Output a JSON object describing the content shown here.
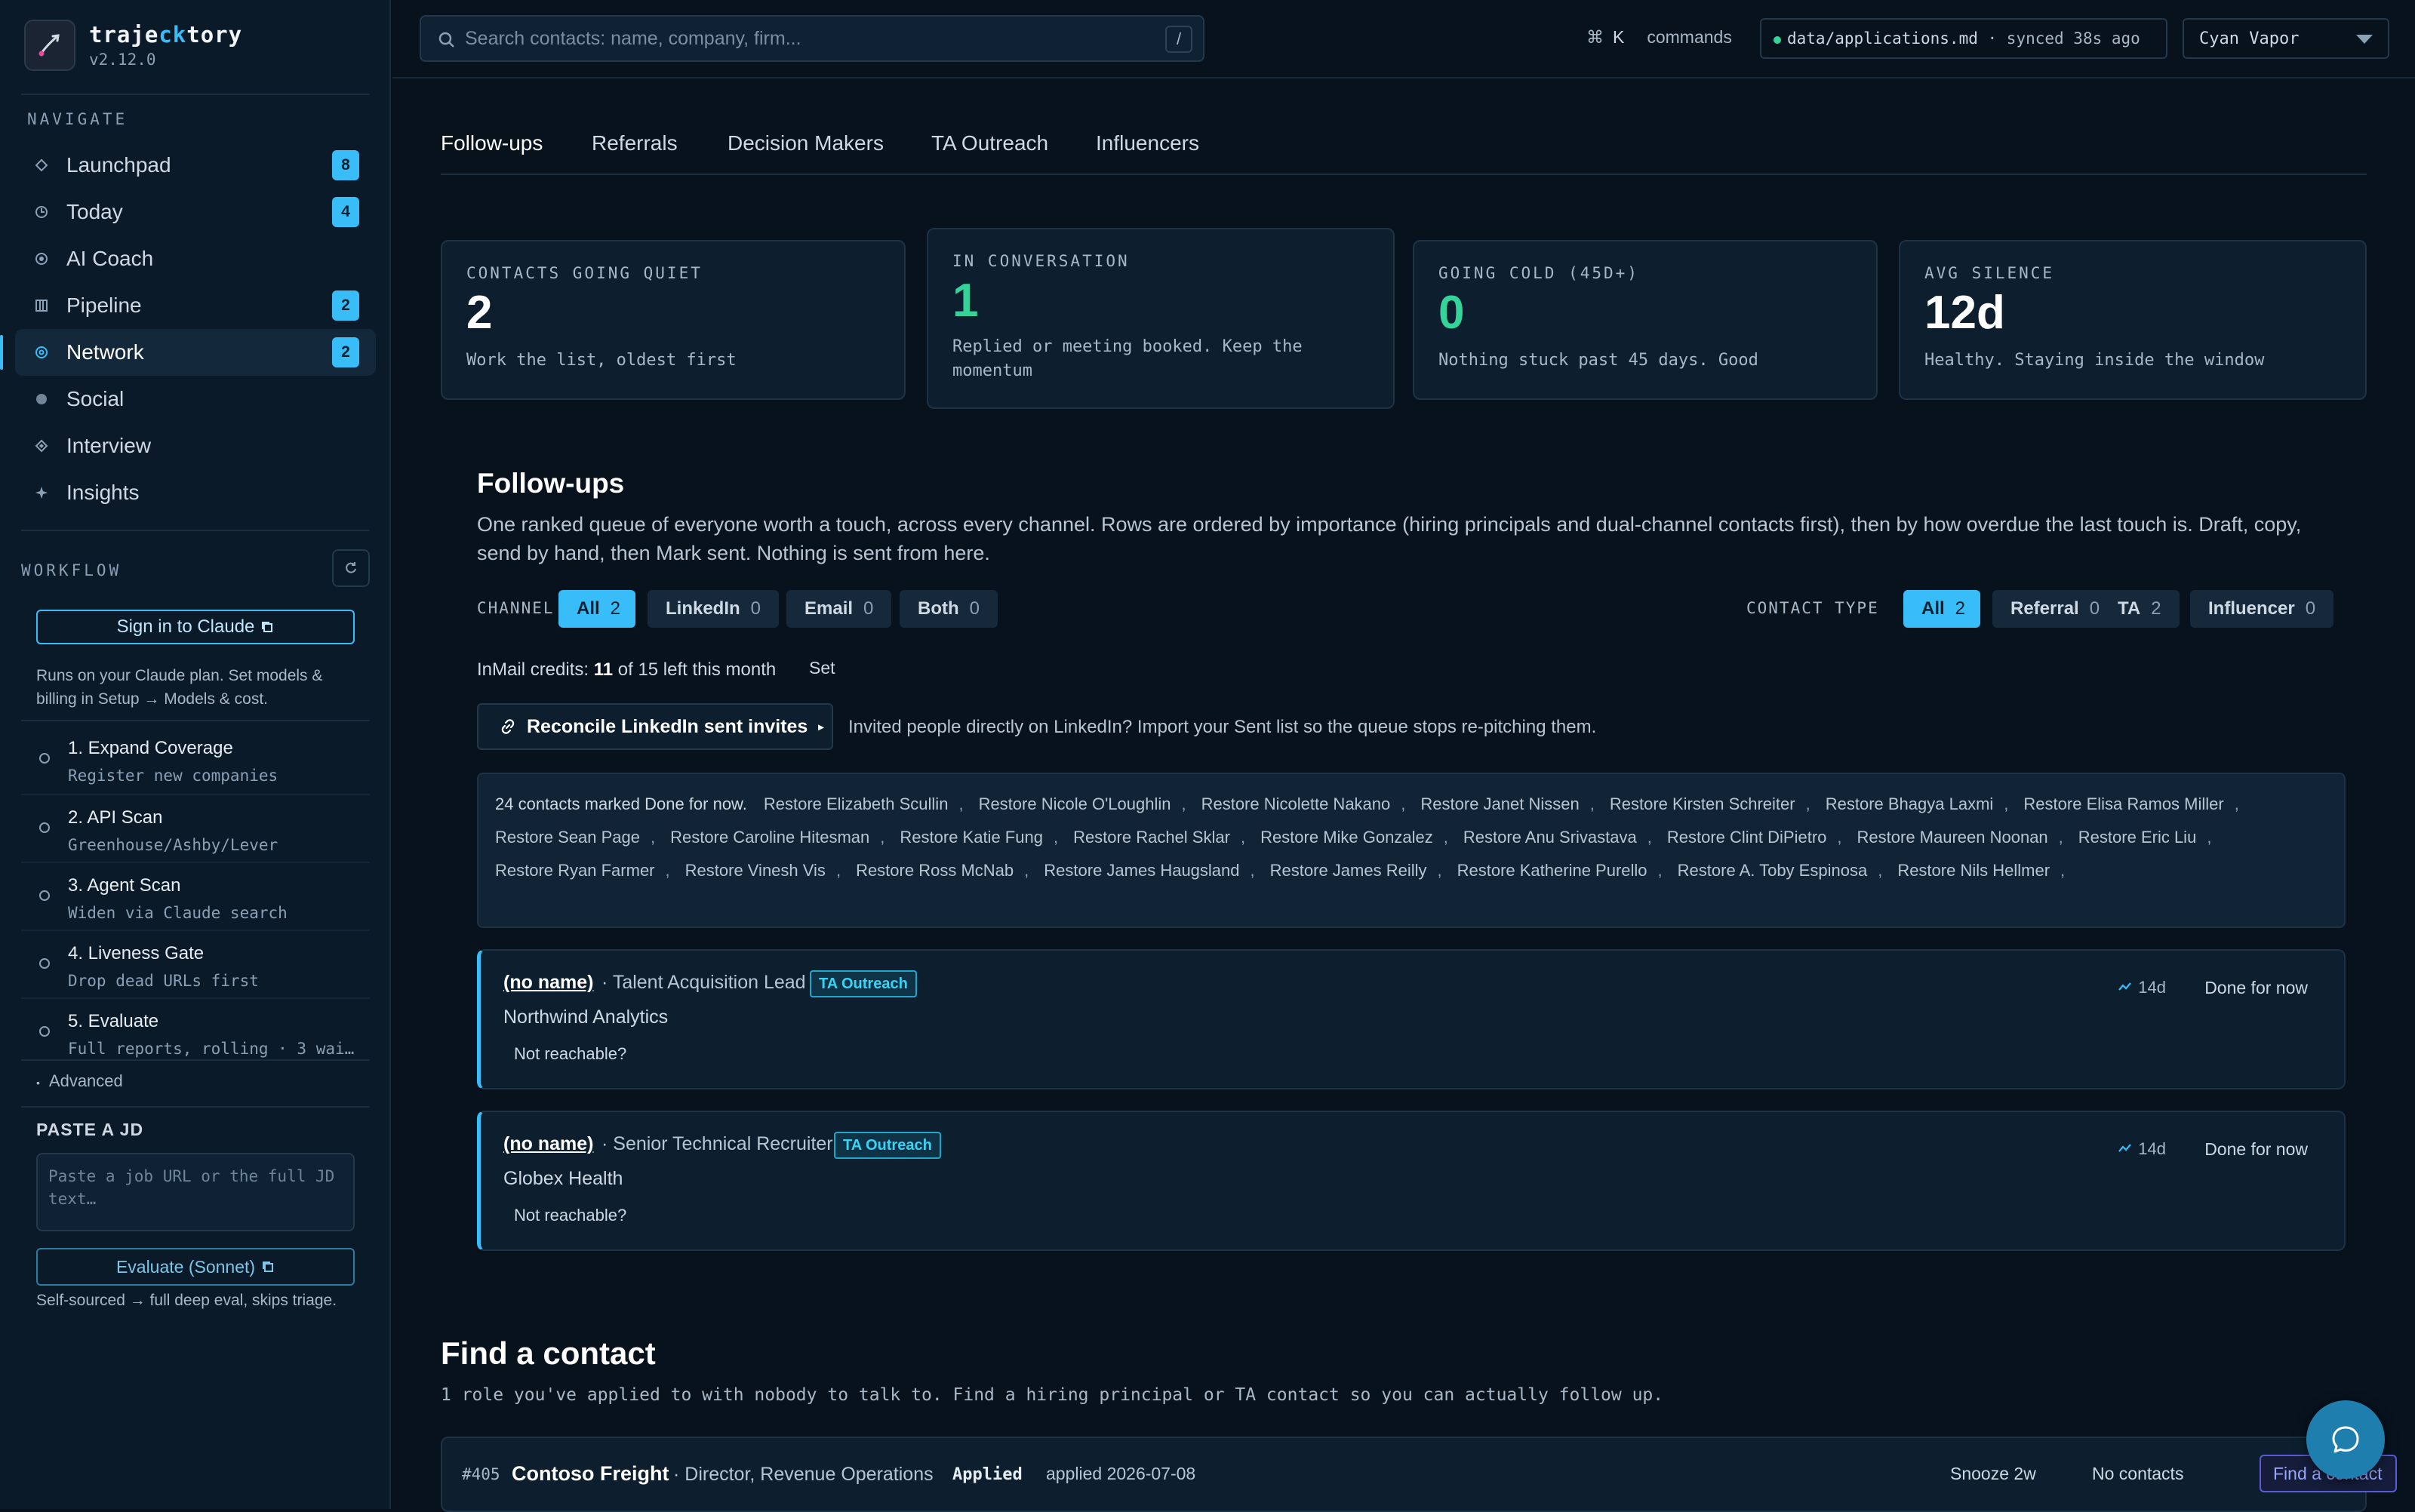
{
  "app": {
    "name_prefix": "traje",
    "name_accent": "ck",
    "name_suffix": "tory",
    "version": "v2.12.0"
  },
  "sidebar": {
    "navigate_title": "NAVIGATE",
    "nav": [
      {
        "label": "Launchpad",
        "badge": "8",
        "icon": "diamond-icon"
      },
      {
        "label": "Today",
        "badge": "4",
        "icon": "clock-icon"
      },
      {
        "label": "AI Coach",
        "badge": "",
        "icon": "target-icon"
      },
      {
        "label": "Pipeline",
        "badge": "2",
        "icon": "columns-icon"
      },
      {
        "label": "Network",
        "badge": "2",
        "icon": "network-icon",
        "active": true
      },
      {
        "label": "Social",
        "badge": "",
        "icon": "circle-icon"
      },
      {
        "label": "Interview",
        "badge": "",
        "icon": "diamond-icon"
      },
      {
        "label": "Insights",
        "badge": "",
        "icon": "sparkle-icon"
      }
    ],
    "workflow_title": "WORKFLOW",
    "signin_label": "Sign in to Claude",
    "plan_note": "Runs on your Claude plan. Set models & billing in Setup → Models & cost.",
    "steps": [
      {
        "title": "1. Expand Coverage",
        "sub": "Register new companies"
      },
      {
        "title": "2. API Scan",
        "sub": "Greenhouse/Ashby/Lever"
      },
      {
        "title": "3. Agent Scan",
        "sub": "Widen via Claude search"
      },
      {
        "title": "4. Liveness Gate",
        "sub": "Drop dead URLs first"
      },
      {
        "title": "5. Evaluate",
        "sub": "Full reports, rolling · 3 wai…"
      }
    ],
    "advanced_label": "Advanced",
    "paste_title": "PASTE A JD",
    "paste_placeholder": "Paste a job URL or the full JD text…",
    "evaluate_label": "Evaluate (Sonnet)",
    "eval_note": "Self-sourced → full deep eval, skips triage."
  },
  "topbar": {
    "search_placeholder": "Search contacts: name, company, firm...",
    "search_key": "/",
    "cmd_symbol": "⌘",
    "cmd_key": "K",
    "cmd_label": "commands",
    "sync_path": "data/applications.md",
    "sync_status": " · synced 38s ago",
    "theme": "Cyan Vapor"
  },
  "tabs": [
    "Follow-ups",
    "Referrals",
    "Decision Makers",
    "TA Outreach",
    "Influencers"
  ],
  "stats": [
    {
      "label": "CONTACTS GOING QUIET",
      "value": "2",
      "desc": "Work the list, oldest first"
    },
    {
      "label": "IN CONVERSATION",
      "value": "1",
      "desc": "Replied or meeting booked. Keep the momentum"
    },
    {
      "label": "GOING COLD (45D+)",
      "value": "0",
      "desc": "Nothing stuck past 45 days. Good"
    },
    {
      "label": "AVG SILENCE",
      "value": "12d",
      "desc": "Healthy. Staying inside the window"
    }
  ],
  "followups": {
    "title": "Follow-ups",
    "desc": "One ranked queue of everyone worth a touch, across every channel. Rows are ordered by importance (hiring principals and dual-channel contacts first), then by how overdue the last touch is. Draft, copy, send by hand, then Mark sent. Nothing is sent from here.",
    "channel_label": "CHANNEL",
    "channels": [
      {
        "label": "All",
        "count": "2"
      },
      {
        "label": "LinkedIn",
        "count": "0"
      },
      {
        "label": "Email",
        "count": "0"
      },
      {
        "label": "Both",
        "count": "0"
      }
    ],
    "type_label": "CONTACT TYPE",
    "types": [
      {
        "label": "All",
        "count": "2"
      },
      {
        "label": "Referral",
        "count": "0"
      },
      {
        "label": "TA",
        "count": "2"
      },
      {
        "label": "Influencer",
        "count": "0"
      }
    ],
    "inmail_prefix": "InMail credits: ",
    "inmail_used": "11",
    "inmail_suffix": " of 15 left this month",
    "set_label": "Set",
    "reconcile_label": "Reconcile LinkedIn sent invites",
    "reconcile_note": "Invited people directly on LinkedIn? Import your Sent list so the queue stops re-pitching them.",
    "done_summary": "24 contacts marked Done for now.",
    "restore": [
      "Restore Elizabeth Scullin",
      "Restore Nicole O'Loughlin",
      "Restore Nicolette Nakano",
      "Restore Janet Nissen",
      "Restore Kirsten Schreiter",
      "Restore Bhagya Laxmi",
      "Restore Elisa Ramos Miller",
      "Restore Sean Page",
      "Restore Caroline Hitesman",
      "Restore Katie Fung",
      "Restore Rachel Sklar",
      "Restore Mike Gonzalez",
      "Restore Anu Srivastava",
      "Restore Clint DiPietro",
      "Restore Maureen Noonan",
      "Restore Eric Liu",
      "Restore Ryan Farmer",
      "Restore Vinesh Vis",
      "Restore Ross McNab",
      "Restore James Haugsland",
      "Restore James Reilly",
      "Restore Katherine Purello",
      "Restore A. Toby Espinosa",
      "Restore Nils Hellmer"
    ],
    "contacts": [
      {
        "name": "(no name)",
        "role": " · Talent Acquisition Lead",
        "tag": "TA Outreach",
        "company": "Northwind Analytics",
        "reach": "Not reachable?",
        "age": "14d",
        "done": "Done for now"
      },
      {
        "name": "(no name)",
        "role": " · Senior Technical Recruiter",
        "tag": "TA Outreach",
        "company": "Globex Health",
        "reach": "Not reachable?",
        "age": "14d",
        "done": "Done for now"
      }
    ]
  },
  "find": {
    "title": "Find a contact",
    "desc": "1 role you've applied to with nobody to talk to. Find a hiring principal or TA contact so you can actually follow up.",
    "row": {
      "id": "#405",
      "company": "Contoso Freight",
      "role": " · Director, Revenue Operations",
      "status": "Applied",
      "date": "applied 2026-07-08",
      "snooze": "Snooze 2w",
      "no_contacts": "No contacts",
      "find_label": "Find a contact"
    }
  },
  "colors": {
    "accent": "#38bdf8",
    "success": "#34d399",
    "background": "#07121d"
  }
}
